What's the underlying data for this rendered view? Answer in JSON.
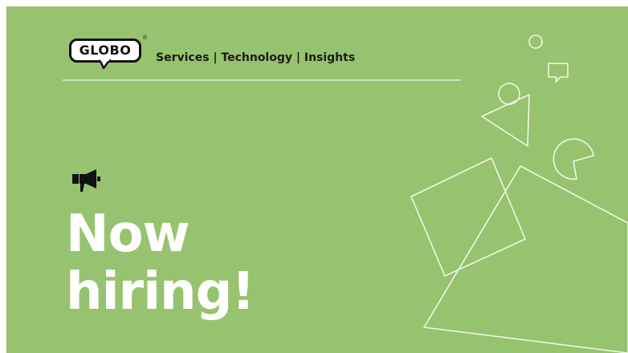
{
  "brand": {
    "logo_text": "GLOBO",
    "registered_mark": "®",
    "tagline": "Services | Technology | Insights"
  },
  "headline": {
    "line1": "Now",
    "line2": "hiring!"
  },
  "colors": {
    "background": "#97c26f",
    "divider": "#d9ebc8",
    "shape_stroke": "#eef6e4",
    "headline": "#ffffff",
    "logo_ink": "#111111"
  },
  "icons": {
    "announcement": "megaphone-icon",
    "chat": "speech-bubble-icon"
  }
}
